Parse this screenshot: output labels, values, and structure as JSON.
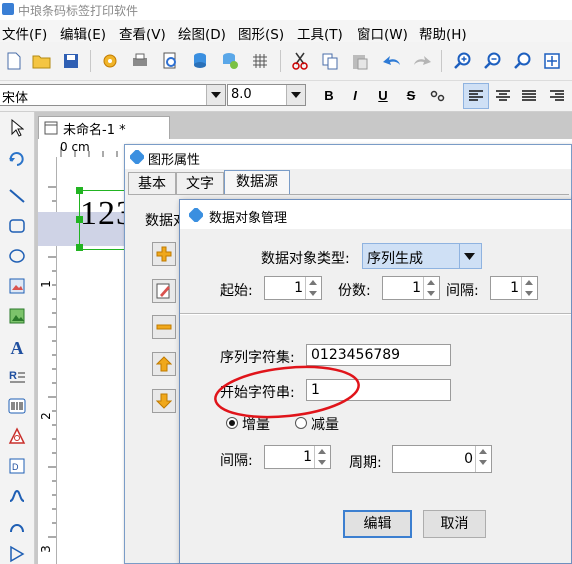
{
  "app": {
    "title": "中琅条码标签打印软件"
  },
  "menu": [
    {
      "label": "文件(F)"
    },
    {
      "label": "编辑(E)"
    },
    {
      "label": "查看(V)"
    },
    {
      "label": "绘图(D)"
    },
    {
      "label": "图形(S)"
    },
    {
      "label": "工具(T)"
    },
    {
      "label": "窗口(W)"
    },
    {
      "label": "帮助(H)"
    }
  ],
  "format_bar": {
    "font_name": "宋体",
    "font_size": "8.0",
    "bold": "B",
    "italic": "I",
    "underline": "U",
    "strike": "S"
  },
  "document": {
    "tab_title": "未命名-1 *",
    "ruler_top_label": "0 cm",
    "ruler_left_marks": [
      "1",
      "2",
      "3"
    ],
    "canvas_text": "123"
  },
  "shape_props_dialog": {
    "title": "图形属性",
    "tabs": [
      "基本",
      "文字",
      "数据源"
    ],
    "active_tab": "数据源",
    "section_label": "数据对"
  },
  "data_object_dialog": {
    "title": "数据对象管理",
    "type_label": "数据对象类型:",
    "type_value": "序列生成",
    "start_label": "起始:",
    "start_value": "1",
    "copies_label": "份数:",
    "copies_value": "1",
    "interval_label": "间隔:",
    "interval_value": "1",
    "charset_label": "序列字符集:",
    "charset_value": "0123456789",
    "start_string_label": "开始字符串:",
    "start_string_value": "1",
    "increment_label": "增量",
    "decrement_label": "减量",
    "selected_mode": "增量",
    "step_label": "间隔:",
    "step_value": "1",
    "period_label": "周期:",
    "period_value": "0",
    "edit_button": "编辑",
    "cancel_button": "取消"
  },
  "colors": {
    "annotation_red": "#e0141a",
    "selection_green": "#22b422",
    "type_combo_bg": "#cfe0f5"
  }
}
